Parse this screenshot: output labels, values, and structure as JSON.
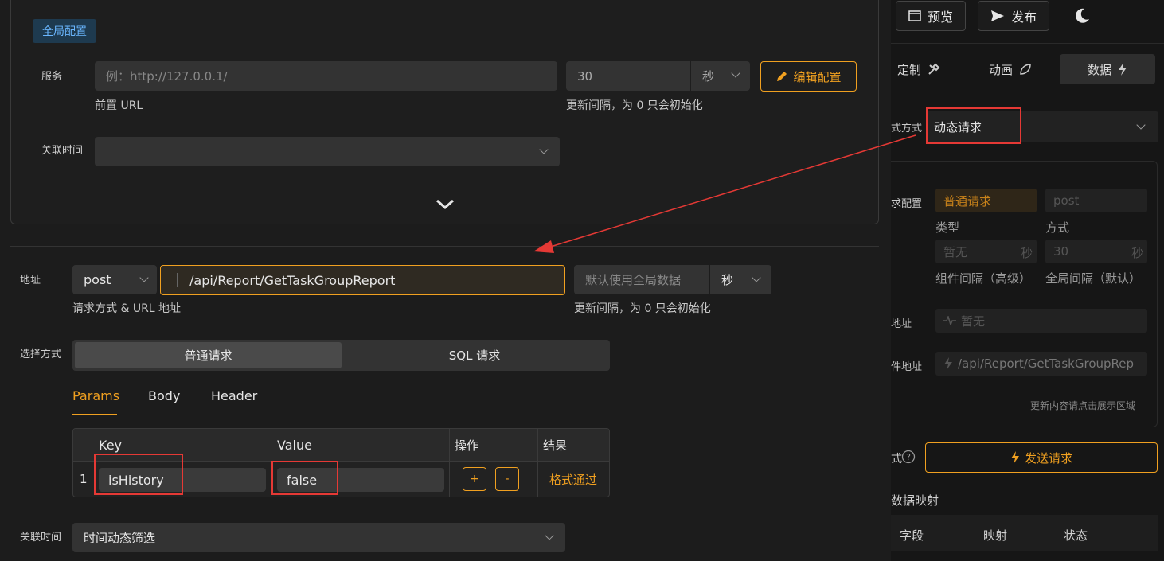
{
  "global": {
    "tag": "全局配置",
    "service_label": "服务",
    "url_placeholder": "例：http://127.0.0.1/",
    "url_caption": "前置 URL",
    "interval_value": "30",
    "interval_unit": "秒",
    "interval_caption": "更新间隔，为 0 只会初始化",
    "edit_button": "编辑配置",
    "related_time_label": "关联时间"
  },
  "request": {
    "address_label": "地址",
    "method": "post",
    "url": "/api/Report/GetTaskGroupReport",
    "address_caption": "请求方式 & URL 地址",
    "interval_placeholder": "默认使用全局数据",
    "interval_unit": "秒",
    "interval_caption": "更新间隔，为 0 只会初始化",
    "select_mode_label": "选择方式",
    "mode_normal": "普通请求",
    "mode_sql": "SQL 请求",
    "tabs": [
      "Params",
      "Body",
      "Header"
    ],
    "table": {
      "headers": [
        "Key",
        "Value",
        "操作",
        "结果"
      ],
      "rows": [
        {
          "index": "1",
          "key": "isHistory",
          "value": "false",
          "add": "+",
          "remove": "-",
          "result": "格式通过"
        }
      ]
    },
    "related_time_label": "关联时间",
    "related_time_value": "时间动态筛选"
  },
  "right_panel": {
    "preview": "预览",
    "publish": "发布",
    "tabs": [
      "定制",
      "动画",
      "数据"
    ],
    "mode_label": "式方式",
    "mode_value": "动态请求",
    "config_label": "求配置",
    "type_value": "普通请求",
    "type_caption": "类型",
    "method_value": "post",
    "method_caption": "方式",
    "comp_interval_value": "暂无",
    "comp_interval_unit": "秒",
    "comp_interval_caption": "组件间隔（高级）",
    "global_interval_value": "30",
    "global_interval_unit": "秒",
    "global_interval_caption": "全局间隔（默认）",
    "addr_label": "地址",
    "addr_value": "暂无",
    "comp_addr_label": "件地址",
    "comp_addr_value": "/api/Report/GetTaskGroupRep",
    "hint": "更新内容请点击展示区域",
    "send_label": "式",
    "send_button": "发送请求",
    "mapping_title": "数据映射",
    "mapping_headers": [
      "字段",
      "映射",
      "状态"
    ]
  },
  "colors": {
    "accent": "#f0a020",
    "annotation": "#e53935"
  }
}
